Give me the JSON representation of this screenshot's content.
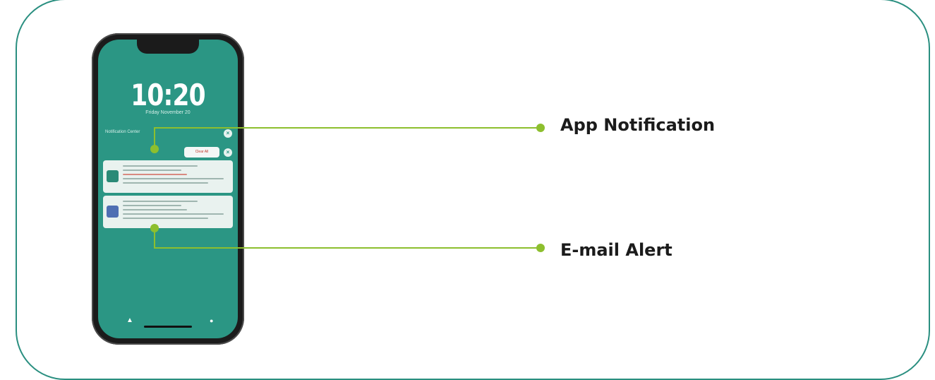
{
  "colors": {
    "accent_teal": "#2a8f80",
    "connector_green": "#8dbf2e",
    "screen_teal": "#2b9684"
  },
  "phone": {
    "time": "10:20",
    "date": "Friday November 20",
    "notification_center_label": "Notification Center",
    "clear_all_label": "Clear All",
    "flashlight_icon": "flashlight-icon",
    "camera_icon": "camera-icon"
  },
  "callouts": {
    "app_notification": "App Notification",
    "email_alert": "E-mail Alert"
  }
}
